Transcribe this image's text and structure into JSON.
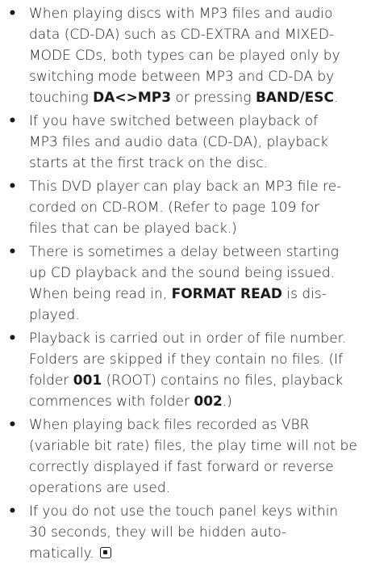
{
  "notes": [
    {
      "lines": [
        "When playing discs with MP3 files and audio",
        "data (CD-DA) such as CD-EXTRA and MIXED-",
        "MODE CDs, both types can be played only by",
        "switching mode between MP3 and CD-DA by"
      ],
      "line5_pre": "touching ",
      "line5_key1": "DA<>MP3",
      "line5_mid": " or pressing ",
      "line5_key2": "BAND/ESC",
      "line5_post": "."
    },
    {
      "lines": [
        "If you have switched between playback of",
        "MP3 files and audio data (CD-DA), playback",
        "starts at the first track on the disc."
      ]
    },
    {
      "lines": [
        "This DVD player can play back an MP3 file re-",
        "corded on CD-ROM. (Refer to page 109 for",
        "files that can be played back.)"
      ]
    },
    {
      "lines": [
        "There is sometimes a delay between starting",
        "up CD playback and the sound being issued."
      ],
      "line3_pre": "When being read in, ",
      "line3_key": "FORMAT READ",
      "line3_post": " is dis-",
      "line4": "played."
    },
    {
      "lines": [
        "Playback is carried out in order of file number.",
        "Folders are skipped if they contain no files. (If"
      ],
      "line3_pre": "folder ",
      "line3_key": "001",
      "line3_post": " (ROOT) contains no files, playback",
      "line4_pre": "commences with folder ",
      "line4_key": "002",
      "line4_post": ".)"
    },
    {
      "lines": [
        "When playing back files recorded as VBR",
        "(variable bit rate) files, the play time will not be",
        "correctly displayed if fast forward or reverse",
        "operations are used."
      ]
    },
    {
      "lines": [
        "If you do not use the touch panel keys within",
        "30 seconds, they will be hidden auto-",
        "matically."
      ],
      "end_icon": "end-of-section-icon"
    }
  ]
}
